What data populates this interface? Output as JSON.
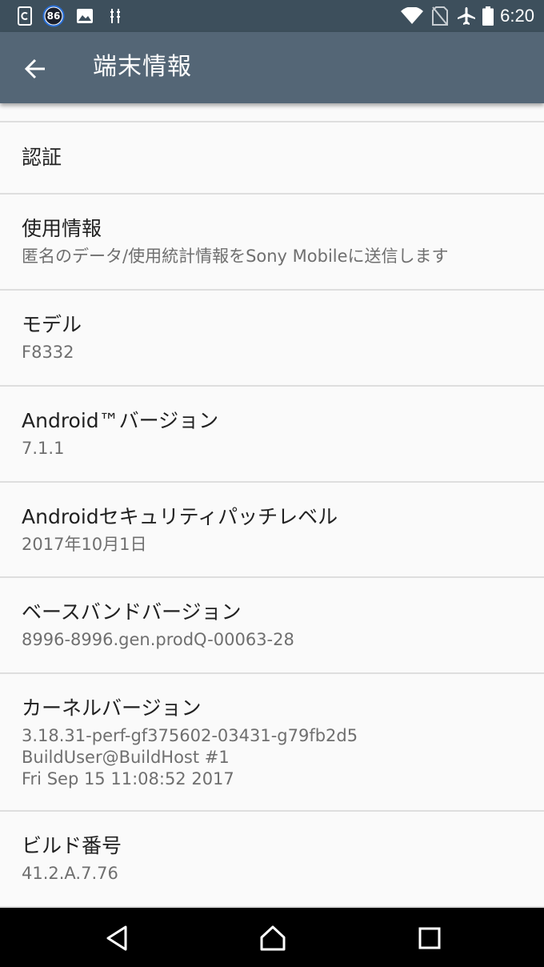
{
  "status_bar": {
    "notification_badge": "86",
    "time": "6:20",
    "icons": [
      "app-notification-icon",
      "badge-86-icon",
      "image-icon",
      "usb-debug-icon",
      "wifi-icon",
      "no-sim-icon",
      "airplane-mode-icon",
      "battery-icon"
    ]
  },
  "app_bar": {
    "title": "端末情報",
    "back_icon": "arrow-back-icon"
  },
  "items": {
    "cert": {
      "title": "認証"
    },
    "usage": {
      "title": "使用情報",
      "summary": "匿名のデータ/使用統計情報をSony Mobileに送信します"
    },
    "model": {
      "title": "モデル",
      "summary": "F8332"
    },
    "android_version": {
      "title": "Android™バージョン",
      "summary": "7.1.1"
    },
    "security_patch": {
      "title": "Androidセキュリティパッチレベル",
      "summary": "2017年10月1日"
    },
    "baseband": {
      "title": "ベースバンドバージョン",
      "summary": "8996-8996.gen.prodQ-00063-28"
    },
    "kernel": {
      "title": "カーネルバージョン",
      "summary_lines": [
        "3.18.31-perf-gf375602-03431-g79fb2d5",
        "BuildUser@BuildHost #1",
        "Fri Sep 15 11:08:52 2017"
      ]
    },
    "build": {
      "title": "ビルド番号",
      "summary": "41.2.A.7.76"
    }
  },
  "nav_bar": {
    "icons": [
      "back-triangle-icon",
      "home-icon",
      "recents-icon"
    ]
  },
  "colors": {
    "status_bar": "#3d4f5c",
    "app_bar": "#546676",
    "background": "#fafafa",
    "divider": "#dedede",
    "summary_text": "#6f6f6f"
  }
}
